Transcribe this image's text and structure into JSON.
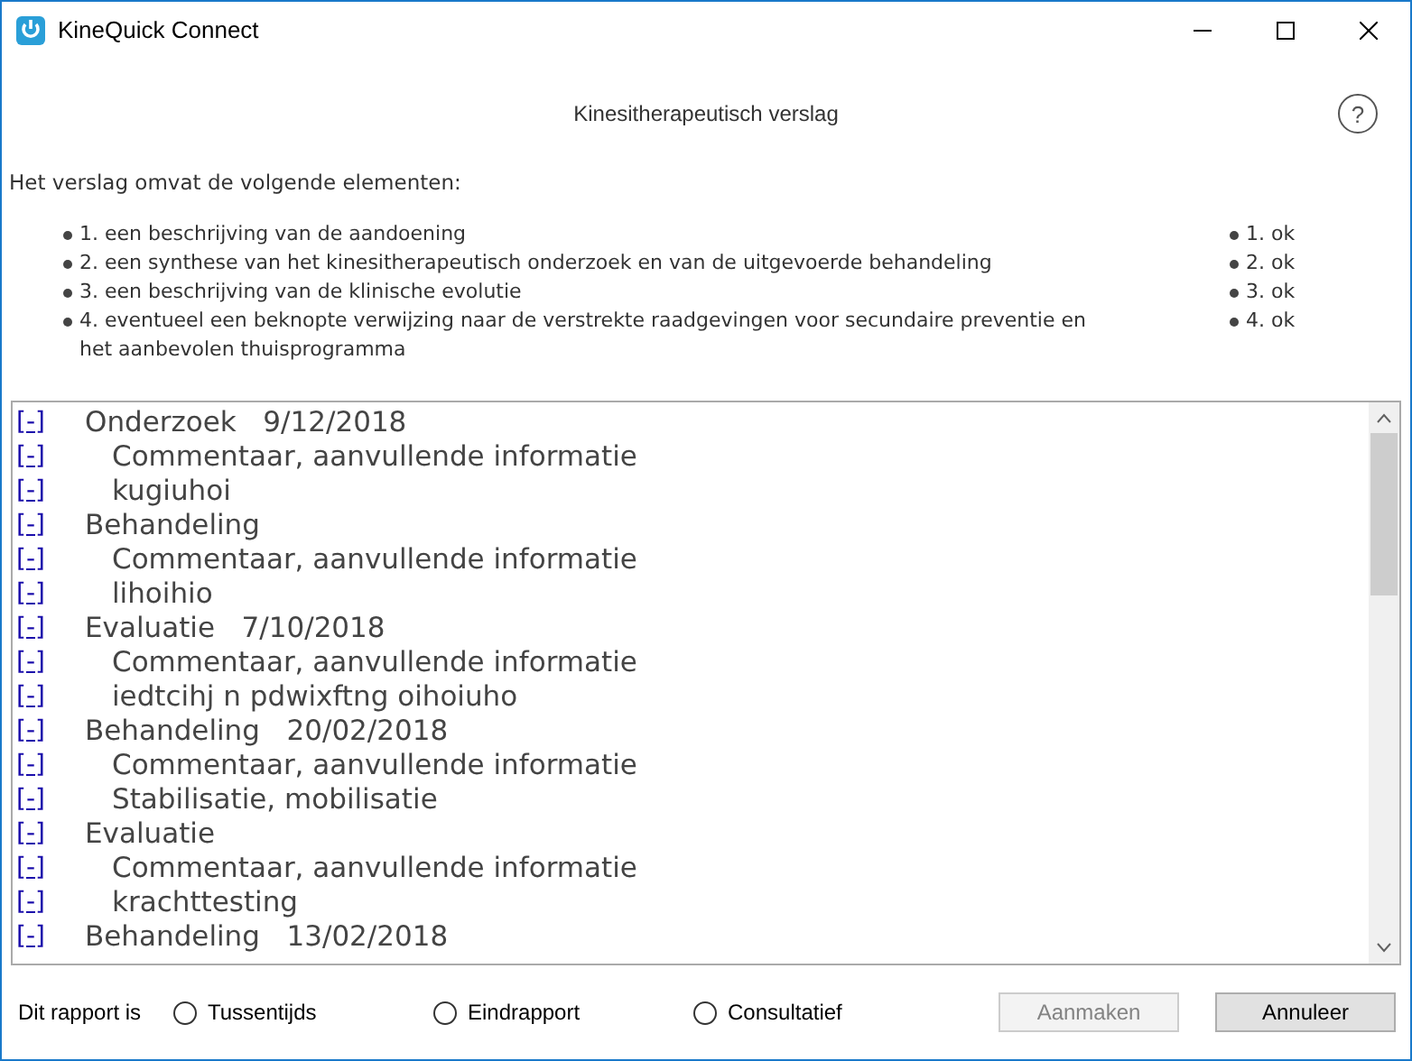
{
  "window": {
    "title": "KineQuick Connect"
  },
  "header": {
    "title": "Kinesitherapeutisch verslag",
    "help": "?"
  },
  "intro": "Het verslag omvat de volgende elementen:",
  "requirements": [
    {
      "text": "1. een beschrijving van de aandoening",
      "status": "1. ok"
    },
    {
      "text": "2. een synthese van het kinesitherapeutisch onderzoek en van de uitgevoerde behandeling",
      "status": "2. ok"
    },
    {
      "text": "3. een beschrijving van de klinische evolutie",
      "status": "3. ok"
    },
    {
      "text": "4. eventueel een beknopte verwijzing naar de verstrekte raadgevingen voor secundaire preventie en het aanbevolen thuisprogramma",
      "status": "4. ok"
    }
  ],
  "tree": [
    {
      "toggle": "[-]",
      "label": "Onderzoek",
      "date": "9/12/2018",
      "children": [
        {
          "toggle": "[-]",
          "label": "Commentaar, aanvullende informatie"
        },
        {
          "toggle": "[-]",
          "label": "kugiuhoi"
        }
      ]
    },
    {
      "toggle": "[-]",
      "label": "Behandeling",
      "children": [
        {
          "toggle": "[-]",
          "label": "Commentaar, aanvullende informatie"
        },
        {
          "toggle": "[-]",
          "label": "lihoihio"
        }
      ]
    },
    {
      "toggle": "[-]",
      "label": "Evaluatie",
      "date": "7/10/2018",
      "children": [
        {
          "toggle": "[-]",
          "label": "Commentaar, aanvullende informatie"
        },
        {
          "toggle": "[-]",
          "label": "iedtcihj n pdwixftng oihoiuho"
        }
      ]
    },
    {
      "toggle": "[-]",
      "label": "Behandeling",
      "date": "20/02/2018",
      "children": [
        {
          "toggle": "[-]",
          "label": "Commentaar, aanvullende informatie"
        },
        {
          "toggle": "[-]",
          "label": "Stabilisatie, mobilisatie"
        }
      ]
    },
    {
      "toggle": "[-]",
      "label": "Evaluatie",
      "children": [
        {
          "toggle": "[-]",
          "label": "Commentaar, aanvullende informatie"
        },
        {
          "toggle": "[-]",
          "label": "krachttesting"
        }
      ]
    },
    {
      "toggle": "[-]",
      "label": "Behandeling",
      "date": "13/02/2018"
    }
  ],
  "report_type": {
    "label": "Dit rapport is",
    "options": [
      {
        "label": "Tussentijds",
        "selected": false
      },
      {
        "label": "Eindrapport",
        "selected": false
      },
      {
        "label": "Consultatief",
        "selected": false
      }
    ]
  },
  "buttons": [
    {
      "label": "Aanmaken",
      "disabled": true
    },
    {
      "label": "Annuleer",
      "disabled": false
    }
  ]
}
